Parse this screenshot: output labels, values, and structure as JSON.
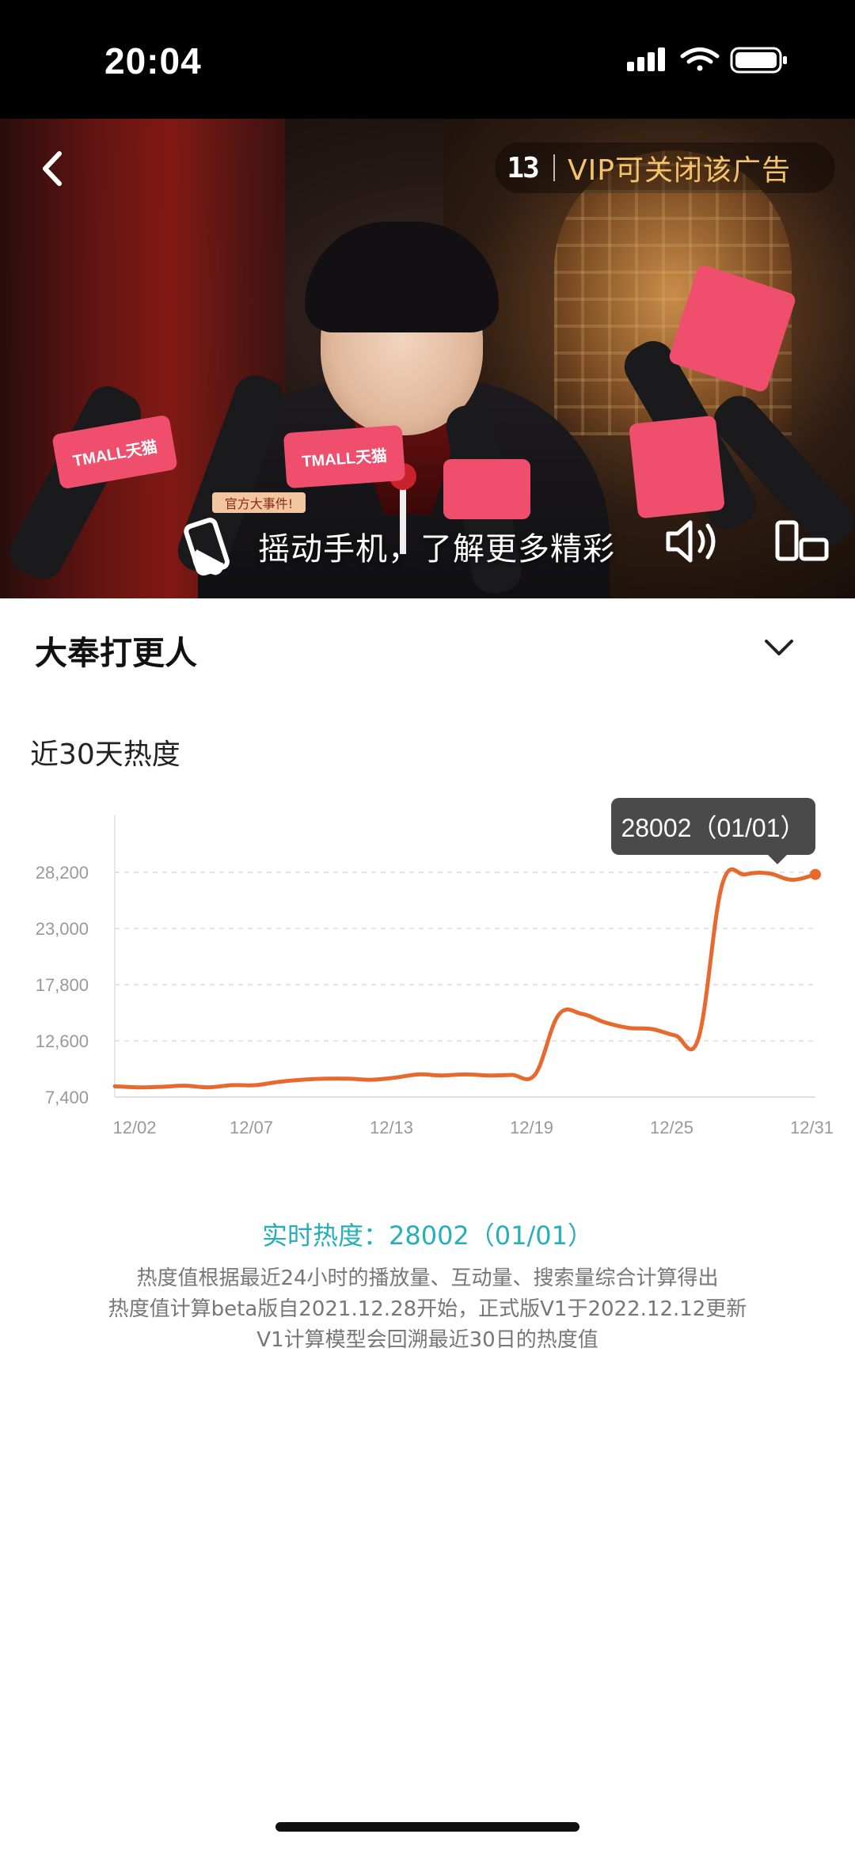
{
  "status_bar": {
    "time": "20:04"
  },
  "video_ad": {
    "countdown": "13",
    "vip_close_text": "VIP可关闭该广告",
    "shake_prompt": "摇动手机，了解更多精彩",
    "news_tag": "官方大事件!",
    "mic_brand": "TMALL天猫"
  },
  "show": {
    "title": "大奉打更人"
  },
  "heat_section": {
    "title": "近30天热度",
    "tooltip": "28002（01/01）",
    "realtime": "实时热度：28002（01/01）",
    "notes": [
      "热度值根据最近24小时的播放量、互动量、搜索量综合计算得出",
      "热度值计算beta版自2021.12.28开始，正式版V1于2022.12.12更新",
      "V1计算模型会回溯最近30日的热度值"
    ]
  },
  "colors": {
    "line": "#e8692e",
    "accent": "#26aeb9",
    "tooltip_bg": "#4a4a4a"
  },
  "chart_data": {
    "type": "line",
    "title": "近30天热度",
    "ylim": [
      7400,
      30000
    ],
    "y_ticks": [
      "28,200",
      "23,000",
      "17,800",
      "12,600",
      "7,400"
    ],
    "y_tick_values": [
      28200,
      23000,
      17800,
      12600,
      7400
    ],
    "x_tick_labels": [
      "12/02",
      "12/07",
      "12/13",
      "12/19",
      "12/25",
      "12/31"
    ],
    "grid": true,
    "series": [
      {
        "x": [
          "12/02",
          "12/03",
          "12/04",
          "12/05",
          "12/06",
          "12/07",
          "12/08",
          "12/09",
          "12/10",
          "12/11",
          "12/12",
          "12/13",
          "12/14",
          "12/15",
          "12/16",
          "12/17",
          "12/18",
          "12/19",
          "12/20",
          "12/21",
          "12/22",
          "12/23",
          "12/24",
          "12/25",
          "12/26",
          "12/27",
          "12/28",
          "12/29",
          "12/30",
          "12/31",
          "01/01"
        ],
        "values": [
          8400,
          8300,
          8350,
          8450,
          8300,
          8500,
          8500,
          8800,
          9000,
          9100,
          9100,
          9000,
          9200,
          9500,
          9400,
          9500,
          9400,
          9450,
          9500,
          15000,
          15100,
          14300,
          13800,
          13700,
          13100,
          12900,
          27000,
          28000,
          28100,
          27500,
          28002
        ]
      }
    ]
  }
}
